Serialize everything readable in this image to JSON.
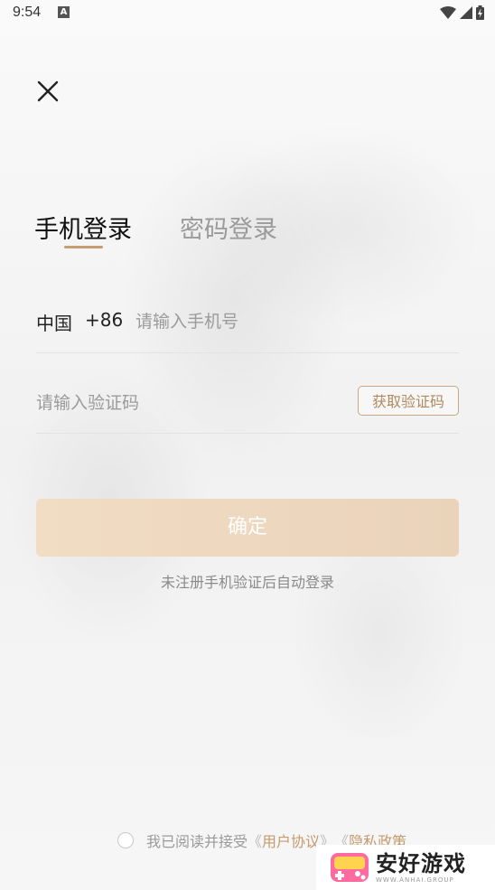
{
  "status_bar": {
    "time": "9:54",
    "notification_icon_letter": "A",
    "icons": [
      "wifi-icon",
      "signal-icon",
      "battery-icon"
    ]
  },
  "header": {
    "close_icon": "close-icon"
  },
  "tabs": [
    {
      "label": "手机登录",
      "active": true
    },
    {
      "label": "密码登录",
      "active": false
    }
  ],
  "phone": {
    "country": "中国",
    "prefix": "+86",
    "placeholder": "请输入手机号",
    "value": ""
  },
  "code": {
    "placeholder": "请输入验证码",
    "value": "",
    "get_code_label": "获取验证码"
  },
  "confirm": {
    "label": "确定"
  },
  "hint": "未注册手机验证后自动登录",
  "agreement": {
    "prefix": "我已阅读并接受",
    "open_quote": "《",
    "close_quote": "》",
    "user_agreement": "用户协议",
    "privacy_policy": "隐私政策",
    "checked": false
  },
  "watermark": {
    "title": "安好游戏",
    "subtitle": "WWW.ANHAI.GROUP"
  },
  "colors": {
    "accent": "#c59e73",
    "button_gradient_start": "#f1dcc4",
    "button_gradient_end": "#ead3ba",
    "link": "#c49b6d"
  }
}
